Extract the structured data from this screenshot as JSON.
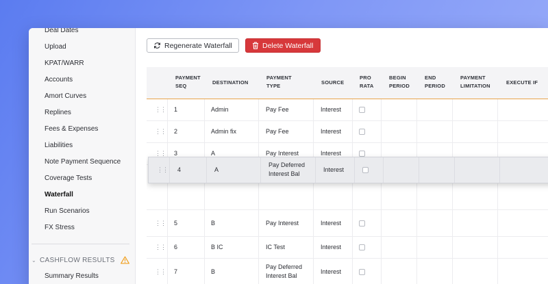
{
  "sidebar": {
    "items": [
      {
        "label": "Deal Dates",
        "active": false
      },
      {
        "label": "Upload",
        "active": false
      },
      {
        "label": "KPAT/WARR",
        "active": false
      },
      {
        "label": "Accounts",
        "active": false
      },
      {
        "label": "Amort Curves",
        "active": false
      },
      {
        "label": "Replines",
        "active": false
      },
      {
        "label": "Fees & Expenses",
        "active": false
      },
      {
        "label": "Liabilities",
        "active": false
      },
      {
        "label": "Note Payment Sequence",
        "active": false
      },
      {
        "label": "Coverage Tests",
        "active": false
      },
      {
        "label": "Waterfall",
        "active": true
      },
      {
        "label": "Run Scenarios",
        "active": false
      },
      {
        "label": "FX Stress",
        "active": false
      }
    ],
    "results_section": {
      "label": "CASHFLOW RESULTS",
      "icon": "warning-icon",
      "items": [
        {
          "label": "Summary Results"
        }
      ]
    }
  },
  "toolbar": {
    "regenerate_label": "Regenerate Waterfall",
    "regenerate_icon": "refresh-icon",
    "delete_label": "Delete Waterfall",
    "delete_icon": "trash-icon"
  },
  "colors": {
    "accent_orange": "#e8a34a",
    "danger_red": "#d7383b",
    "warning_yellow": "#f0a020",
    "background_blue": "#6f8af3"
  },
  "table": {
    "headers": [
      {
        "line1": "PAYMENT",
        "line2": "SEQ"
      },
      {
        "line1": "DESTINATION",
        "line2": ""
      },
      {
        "line1": "PAYMENT",
        "line2": "TYPE"
      },
      {
        "line1": "SOURCE",
        "line2": ""
      },
      {
        "line1": "PRO",
        "line2": "RATA"
      },
      {
        "line1": "BEGIN",
        "line2": "PERIOD"
      },
      {
        "line1": "END",
        "line2": "PERIOD"
      },
      {
        "line1": "PAYMENT",
        "line2": "LIMITATION"
      },
      {
        "line1": "EXECUTE IF",
        "line2": ""
      }
    ],
    "rows": [
      {
        "seq": "1",
        "destination": "Admin",
        "type_line1": "Pay Fee",
        "type_line2": "",
        "source": "Interest"
      },
      {
        "seq": "2",
        "destination": "Admin fix",
        "type_line1": "Pay Fee",
        "type_line2": "",
        "source": "Interest"
      },
      {
        "seq": "3",
        "destination": "A",
        "type_line1": "Pay Interest",
        "type_line2": "",
        "source": "Interest"
      },
      {
        "seq": "",
        "destination": "",
        "type_line1": "",
        "type_line2": "",
        "source": ""
      },
      {
        "seq": "5",
        "destination": "B",
        "type_line1": "Pay Interest",
        "type_line2": "",
        "source": "Interest"
      },
      {
        "seq": "6",
        "destination": "B IC",
        "type_line1": "IC Test",
        "type_line2": "",
        "source": "Interest"
      },
      {
        "seq": "7",
        "destination": "B",
        "type_line1": "Pay Deferred",
        "type_line2": "Interest Bal",
        "source": "Interest"
      }
    ],
    "dragging_row": {
      "seq": "4",
      "destination": "A",
      "type_line1": "Pay Deferred",
      "type_line2": "Interest Bal",
      "source": "Interest"
    }
  }
}
